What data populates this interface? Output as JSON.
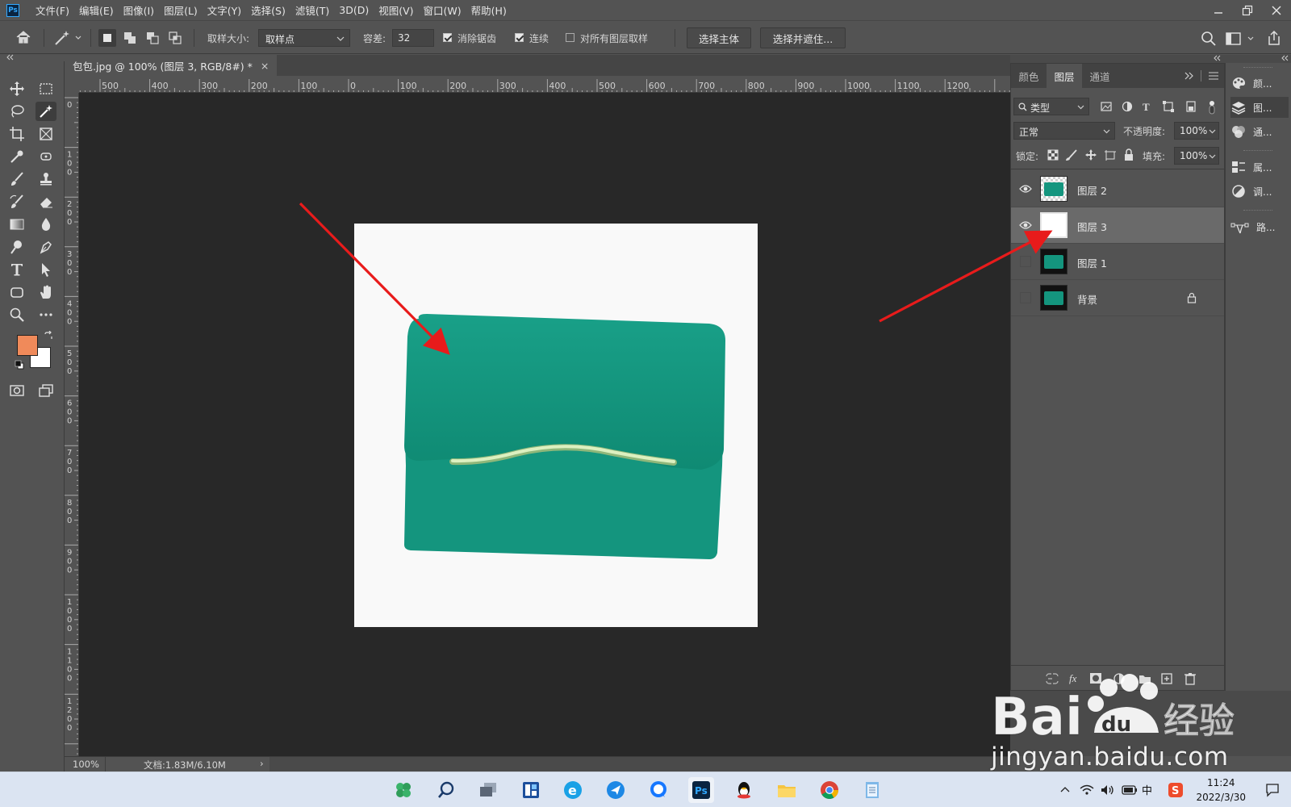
{
  "app": {
    "logo": "Ps",
    "menu": [
      "文件(F)",
      "编辑(E)",
      "图像(I)",
      "图层(L)",
      "文字(Y)",
      "选择(S)",
      "滤镜(T)",
      "3D(D)",
      "视图(V)",
      "窗口(W)",
      "帮助(H)"
    ],
    "window_buttons": [
      "minimize-icon",
      "restore-icon",
      "close-icon"
    ]
  },
  "options": {
    "sample_size_label": "取样大小:",
    "sample_size_value": "取样点",
    "tolerance_label": "容差:",
    "tolerance_value": "32",
    "antialias_label": "消除锯齿",
    "antialias_checked": true,
    "contiguous_label": "连续",
    "contiguous_checked": true,
    "sample_all_label": "对所有图层取样",
    "sample_all_checked": false,
    "select_subject": "选择主体",
    "select_mask": "选择并遮住..."
  },
  "document": {
    "tab_title": "包包.jpg @ 100% (图层 3, RGB/8#) *",
    "close_glyph": "×",
    "ruler_h": [
      "500",
      "400",
      "300",
      "200",
      "100",
      "0",
      "100",
      "200",
      "300",
      "400",
      "500",
      "600",
      "700",
      "800",
      "900",
      "1000",
      "1100",
      "1200"
    ],
    "ruler_v": [
      "0",
      "1 0 0",
      "2 0 0",
      "3 0 0",
      "4 0 0",
      "5 0 0",
      "6 0 0",
      "7 0 0",
      "8 0 0",
      "9 0 0",
      "1 0 0 0",
      "1 1 0 0",
      "1 2 0 0"
    ],
    "bag_color": "#14957e",
    "handle_color": "#d8edb8"
  },
  "status": {
    "zoom": "100%",
    "doc_size": "文档:1.83M/6.10M",
    "arrow": "›"
  },
  "swatches": {
    "foreground": "#f08a5a",
    "background": "#ffffff"
  },
  "layers_panel": {
    "tabs": [
      "颜色",
      "图层",
      "通道"
    ],
    "active_tab": 1,
    "filter_value": "类型",
    "blend_mode": "正常",
    "opacity_label": "不透明度:",
    "opacity_value": "100%",
    "lock_label": "锁定:",
    "fill_label": "填充:",
    "fill_value": "100%",
    "layers": [
      {
        "name": "图层 2",
        "visible": true,
        "thumb": "teal-transparent",
        "locked": false,
        "selected": false
      },
      {
        "name": "图层 3",
        "visible": true,
        "thumb": "white",
        "locked": false,
        "selected": true
      },
      {
        "name": "图层 1",
        "visible": false,
        "thumb": "teal-dark",
        "locked": false,
        "selected": false
      },
      {
        "name": "背景",
        "visible": false,
        "thumb": "teal-dark",
        "locked": true,
        "selected": false
      }
    ]
  },
  "mini_panels": [
    {
      "label": "颜...",
      "icon": "palette-icon"
    },
    {
      "label": "图...",
      "icon": "layers-icon"
    },
    {
      "label": "通...",
      "icon": "channels-icon"
    },
    {
      "label": "属...",
      "icon": "properties-icon"
    },
    {
      "label": "调...",
      "icon": "adjustments-icon"
    },
    {
      "label": "路...",
      "icon": "paths-icon"
    }
  ],
  "taskbar": {
    "time": "11:24",
    "date": "2022/3/30",
    "ime": "中"
  },
  "watermark": {
    "brand": "Bai",
    "brand_du": "du",
    "brand_cn": "经验",
    "sub": "jingyan.baidu.com"
  },
  "annotation_color": "#e81b1b"
}
